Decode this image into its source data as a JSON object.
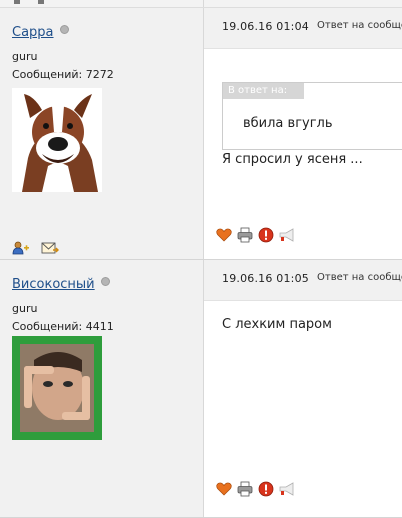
{
  "posts": [
    {
      "username": "Сарра",
      "rank": "guru",
      "messages_label": "Сообщений:",
      "messages_count": "7272",
      "date": "19.06.16 01:04",
      "reply_link": "Ответ на сообщение",
      "quote": {
        "label": "В ответ на:",
        "text": "вбила вгугль"
      },
      "body": "Я спросил у ясеня ..."
    },
    {
      "username": "Високосный",
      "rank": "guru",
      "messages_label": "Сообщений:",
      "messages_count": "4411",
      "date": "19.06.16 01:05",
      "reply_link": "Ответ на сообщение",
      "body": "С лехким паром"
    }
  ],
  "colors": {
    "link": "#1f4f8a",
    "user_panel_bg": "#f1f1f1",
    "avatar_frame_green": "#2e9d3c"
  },
  "icons": {
    "user_actions": [
      "add-friend-icon",
      "private-message-icon"
    ],
    "post_actions": [
      "heart-icon",
      "print-icon",
      "report-icon",
      "megaphone-icon"
    ]
  }
}
